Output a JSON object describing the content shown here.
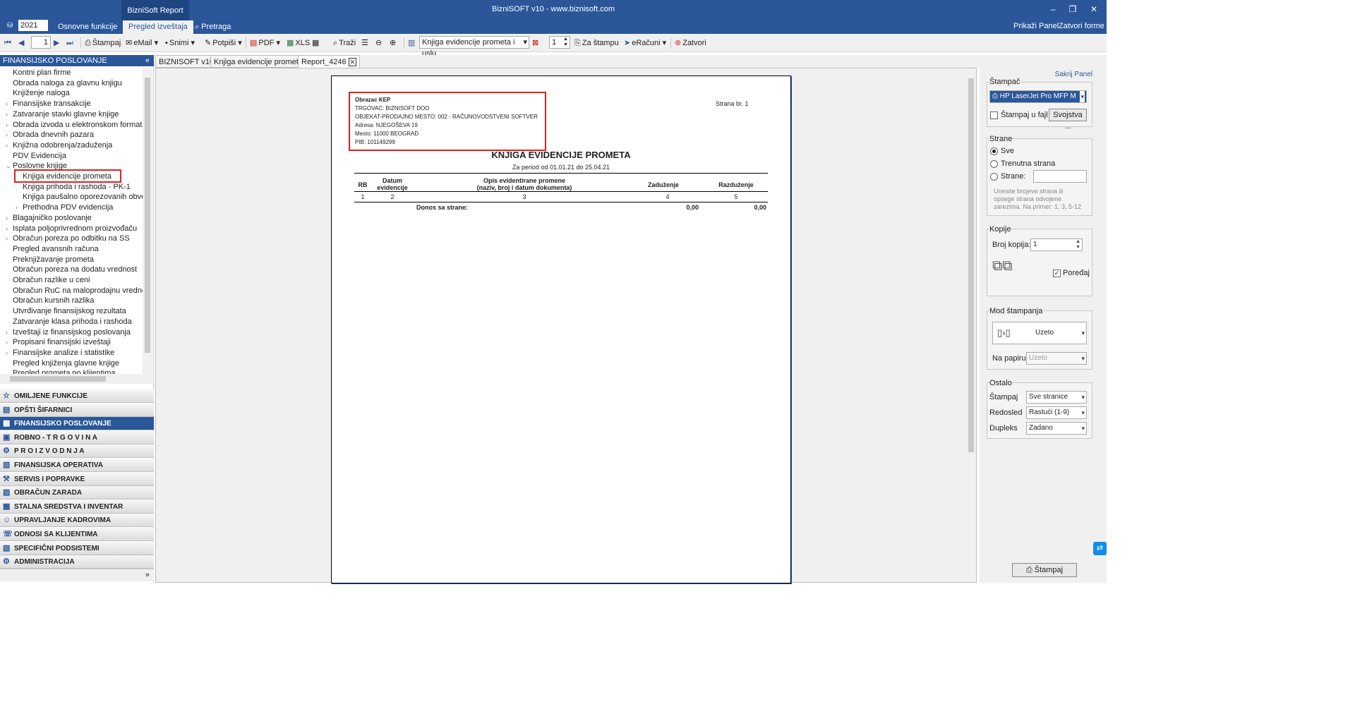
{
  "window": {
    "title": "BizniSOFT v10 - www.biznisoft.com",
    "context_tab": "BizniSoft Report",
    "minimize": "–",
    "restore": "❐",
    "close": "✕",
    "year": "2021",
    "ribbon_tabs": [
      "Osnovne funkcije",
      "Pregled izveštaja",
      "Pretraga"
    ],
    "right_links": [
      "Prikaži Panel",
      "Zatvori forme"
    ]
  },
  "toolbar": {
    "page_value": "1",
    "stampaj": "Štampaj",
    "email": "eMail",
    "snimi": "Snimi",
    "potpisi": "Potpiši",
    "pdf": "PDF",
    "xls": "XLS",
    "trazi": "Traži",
    "report_select": "Knjiga evidencije prometa i uslu",
    "copies_value": "1",
    "za_stampu": "Za štampu",
    "eracuni": "eRačuni",
    "zatvori": "Zatvori"
  },
  "doc_tabs": [
    "BIZNISOFT v10",
    "Knjiga evidencije prometa",
    "Report_4246"
  ],
  "left_panel": {
    "header": "FINANSIJSKO POSLOVANJE",
    "tree": [
      {
        "label": "Kontni plan firme",
        "arrow": "",
        "indent": 0
      },
      {
        "label": "Obrada naloga za glavnu knjigu",
        "arrow": "",
        "indent": 0
      },
      {
        "label": "Knjiženje naloga",
        "arrow": "",
        "indent": 0
      },
      {
        "label": "Finansijske transakcije",
        "arrow": ">",
        "indent": 0
      },
      {
        "label": "Zatvaranje stavki glavne knjige",
        "arrow": ">",
        "indent": 0
      },
      {
        "label": "Obrada izvoda u elektronskom formatu",
        "arrow": ">",
        "indent": 0
      },
      {
        "label": "Obrada dnevnih pazara",
        "arrow": ">",
        "indent": 0
      },
      {
        "label": "Knjižna odobrenja/zaduženja",
        "arrow": ">",
        "indent": 0
      },
      {
        "label": "PDV Evidencija",
        "arrow": "",
        "indent": 0
      },
      {
        "label": "Poslovne knjige",
        "arrow": "v",
        "indent": 0
      },
      {
        "label": "Knjiga evidencije prometa",
        "arrow": "",
        "indent": 1
      },
      {
        "label": "Knjiga prihoda i rashoda - PK-1",
        "arrow": "",
        "indent": 1
      },
      {
        "label": "Knjiga paušalno oporezovanih obve",
        "arrow": "",
        "indent": 1
      },
      {
        "label": "Prethodna PDV evidencija",
        "arrow": ">",
        "indent": 1
      },
      {
        "label": "Blagajničko poslovanje",
        "arrow": ">",
        "indent": 0
      },
      {
        "label": "Isplata poljoprivrednom proizvođaču",
        "arrow": ">",
        "indent": 0
      },
      {
        "label": "Obračun poreza po odbitku na SS",
        "arrow": ">",
        "indent": 0
      },
      {
        "label": "Pregled avansnih računa",
        "arrow": "",
        "indent": 0
      },
      {
        "label": "Preknjižavanje prometa",
        "arrow": "",
        "indent": 0
      },
      {
        "label": "Obračun poreza na dodatu vrednost",
        "arrow": "",
        "indent": 0
      },
      {
        "label": "Obračun razlike u ceni",
        "arrow": "",
        "indent": 0
      },
      {
        "label": "Obračun RuC na maloprodajnu vrednost",
        "arrow": "",
        "indent": 0
      },
      {
        "label": "Obračun kursnih razlika",
        "arrow": "",
        "indent": 0
      },
      {
        "label": "Utvrđivanje finansijskog rezultata",
        "arrow": "",
        "indent": 0
      },
      {
        "label": "Zatvaranje klasa prihoda i rashoda",
        "arrow": "",
        "indent": 0
      },
      {
        "label": "Izveštaji iz finansijskog poslovanja",
        "arrow": ">",
        "indent": 0
      },
      {
        "label": "Propisani finansijski izveštaji",
        "arrow": ">",
        "indent": 0
      },
      {
        "label": "Finansijske analize i statistike",
        "arrow": ">",
        "indent": 0
      },
      {
        "label": "Pregled knjiženja glavne knjige",
        "arrow": "",
        "indent": 0
      },
      {
        "label": "Pregled prometa po klijentima",
        "arrow": "",
        "indent": 0
      }
    ],
    "sections": [
      {
        "label": "OMILJENE FUNKCIJE",
        "icon": "☆"
      },
      {
        "label": "OPŠTI ŠIFARNICI",
        "icon": "▤"
      },
      {
        "label": "FINANSIJSKO POSLOVANJE",
        "icon": "▦"
      },
      {
        "label": "ROBNO - T R G O V I N A",
        "icon": "▣"
      },
      {
        "label": "P R O I Z V O D N J A",
        "icon": "⚙"
      },
      {
        "label": "FINANSIJSKA OPERATIVA",
        "icon": "▥"
      },
      {
        "label": "SERVIS I POPRAVKE",
        "icon": "⚒"
      },
      {
        "label": "OBRAČUN ZARADA",
        "icon": "▨"
      },
      {
        "label": "STALNA SREDSTVA I INVENTAR",
        "icon": "▩"
      },
      {
        "label": "UPRAVLJANJE KADROVIMA",
        "icon": "☺"
      },
      {
        "label": "ODNOSI SA KLIJENTIMA",
        "icon": "☏"
      },
      {
        "label": "SPECIFIČNI PODSISTEMI",
        "icon": "▧"
      },
      {
        "label": "ADMINISTRACIJA",
        "icon": "⚙"
      }
    ],
    "more": "»"
  },
  "report": {
    "header_lines": [
      "Obrazac KEP",
      "TRGOVAC: BIZNISOFT DOO",
      "OBJEKAT-PRODAJNO MESTO: 002 - RAČUNOVODSTVENI SOFTVER",
      "Adresa: NJEGOŠEVA 19",
      "Mesto: 11000 BEOGRAD",
      "PIB: 101149299"
    ],
    "page_label": "Strana br. 1",
    "title": "KNJIGA EVIDENCIJE PROMETA",
    "period": "Za period od 01.01.21 do 25.04.21",
    "columns": [
      "RB",
      "Datum\nevidencije",
      "Opis evidentirane promene\n(naziv, broj i datum dokumenta)",
      "Zaduženje",
      "Razduženje"
    ],
    "column_numbers": [
      "1",
      "2",
      "3",
      "4",
      "5"
    ],
    "total_label": "Donos sa strane:",
    "total_zaduzenje": "0,00",
    "total_razduzenje": "0,00"
  },
  "print_panel": {
    "hide_panel": "Sakrij Panel",
    "printer_group": "Štampač",
    "printer": "HP LaserJet Pro MFP M",
    "print_to_file": "Štampaj u fajl",
    "properties": "Svojstva ...",
    "pages_group": "Strane",
    "all": "Sve",
    "current": "Trenutna strana",
    "pages": "Strane:",
    "pages_hint": "Unesite brojeve strana ili opsege strana odvojene zarezima. Na primer: 1, 3, 5-12",
    "copies_group": "Kopije",
    "copies_label": "Broj kopija:",
    "copies_value": "1",
    "collate": "Poređaj",
    "mode_group": "Mod štampanja",
    "mode_value": "Uzeto",
    "on_paper_label": "Na papiru",
    "on_paper_value": "Uzeto",
    "other_group": "Ostalo",
    "print_label": "Štampaj",
    "print_value": "Sve stranice",
    "order_label": "Redosled",
    "order_value": "Rastući (1-9)",
    "duplex_label": "Dupleks",
    "duplex_value": "Zadano",
    "print_button": "Štampaj"
  }
}
